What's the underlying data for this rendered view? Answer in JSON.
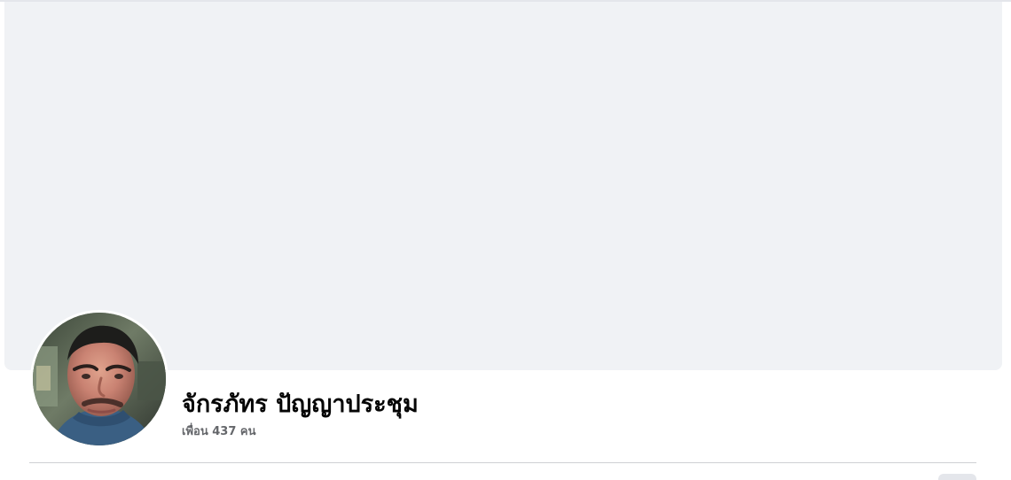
{
  "profile": {
    "name": "จักรภัทร ปัญญาประชุม",
    "friends": "เพื่อน 437 คน"
  },
  "icons": {
    "avatar": "profile-photo",
    "more": "more-options-icon"
  },
  "colors": {
    "cover": "#f0f2f5",
    "name": "#050505",
    "secondary_text": "#65676b",
    "divider": "#ced0d4",
    "button": "#e4e6eb"
  }
}
